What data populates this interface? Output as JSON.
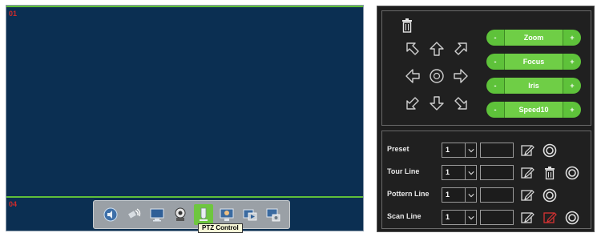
{
  "video": {
    "channel_top": "01",
    "channel_bottom": "04"
  },
  "toolbar": {
    "icons": [
      "speaker-icon",
      "satellite-icon",
      "monitor-icon",
      "video-camera-icon",
      "ptz-bulb-icon",
      "display-settings-icon",
      "playback-icon",
      "record-icon"
    ],
    "tooltip": "PTZ Control"
  },
  "ptz": {
    "controls": [
      {
        "minus": "-",
        "label": "Zoom",
        "plus": "+"
      },
      {
        "minus": "-",
        "label": "Focus",
        "plus": "+"
      },
      {
        "minus": "-",
        "label": "Iris",
        "plus": "+"
      },
      {
        "minus": "-",
        "label": "Speed10",
        "plus": "+"
      }
    ]
  },
  "presets": {
    "rows": [
      {
        "label": "Preset",
        "value": "1"
      },
      {
        "label": "Tour Line",
        "value": "1"
      },
      {
        "label": "Pottern Line",
        "value": "1"
      },
      {
        "label": "Scan Line",
        "value": "1"
      }
    ]
  },
  "colors": {
    "video_bg": "#0b2f52",
    "accent_green": "#6fce46",
    "panel_bg": "#1e1e1e",
    "channel_label": "#cc2b2b"
  }
}
